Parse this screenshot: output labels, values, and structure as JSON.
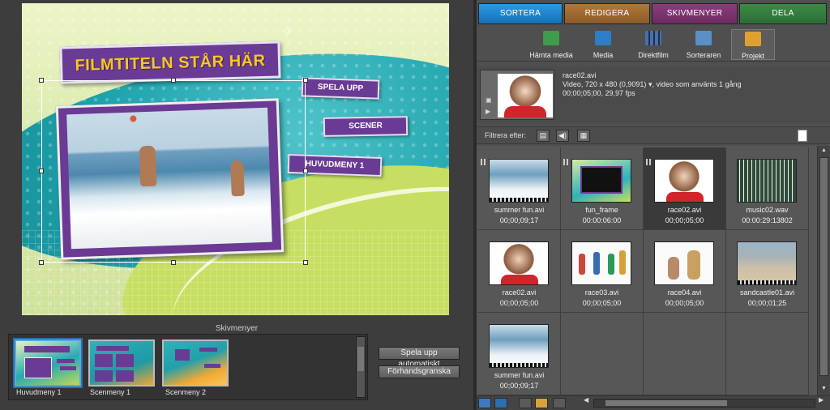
{
  "menu_editor": {
    "title_text": "FILMTITELN STÅR HÄR",
    "buttons": [
      "SPELA UPP",
      "SCENER",
      "HUVUDMENY 1"
    ],
    "section_label": "Skivmenyer",
    "menus": [
      {
        "label": "Huvudmeny 1",
        "selected": true,
        "thumb_title": "FILMTITELN STÅR HÄR"
      },
      {
        "label": "Scenmeny 1",
        "selected": false,
        "thumb_title": "MALLA NAMN"
      },
      {
        "label": "Scenmeny 2",
        "selected": false,
        "thumb_title": "MALLA NAMN"
      }
    ],
    "autoplay_button": "Spela upp automatiskt",
    "preview_button": "Förhandsgranska"
  },
  "organizer": {
    "tabs": [
      {
        "label": "SORTERA",
        "active": true
      },
      {
        "label": "REDIGERA",
        "active": false
      },
      {
        "label": "SKIVMENYER",
        "active": false
      },
      {
        "label": "DELA",
        "active": false
      }
    ],
    "tools": [
      {
        "label": "Hämta media",
        "icon": "import-media-icon",
        "color": "#3f9c4a"
      },
      {
        "label": "Media",
        "icon": "media-icon",
        "color": "#2c7fc4"
      },
      {
        "label": "Direktfilm",
        "icon": "instant-movie-icon",
        "color": "#4a6fa8"
      },
      {
        "label": "Sorteraren",
        "icon": "organizer-icon",
        "color": "#5a8fc8"
      },
      {
        "label": "Projekt",
        "icon": "project-icon",
        "color": "#e0a030",
        "selected": true
      }
    ],
    "info": {
      "filename": "race02.avi",
      "details": "Video, 720 x 480 (0,9091)",
      "usage": ", video som använts 1 gång",
      "duration": "00;00;05;00, 29,97 fps"
    },
    "filter_label": "Filtrera efter:",
    "items": [
      {
        "name": "summer fun.avi",
        "duration": "00;00;09;17",
        "thumb": "beach"
      },
      {
        "name": "fun_frame",
        "duration": "00:00:06:00",
        "thumb": "frame"
      },
      {
        "name": "race02.avi",
        "duration": "00;00;05;00",
        "thumb": "kid",
        "selected": true
      },
      {
        "name": "music02.wav",
        "duration": "00:00:29:13802",
        "thumb": "wave"
      },
      {
        "name": "race02.avi",
        "duration": "00;00;05;00",
        "thumb": "kid"
      },
      {
        "name": "race03.avi",
        "duration": "00;00;05;00",
        "thumb": "runners"
      },
      {
        "name": "race04.avi",
        "duration": "00;00;05;00",
        "thumb": "runners2"
      },
      {
        "name": "sandcastle01.avi",
        "duration": "00;00;01;25",
        "thumb": "sand"
      },
      {
        "name": "summer fun.avi",
        "duration": "00;00;09;17",
        "thumb": "beach"
      }
    ]
  }
}
